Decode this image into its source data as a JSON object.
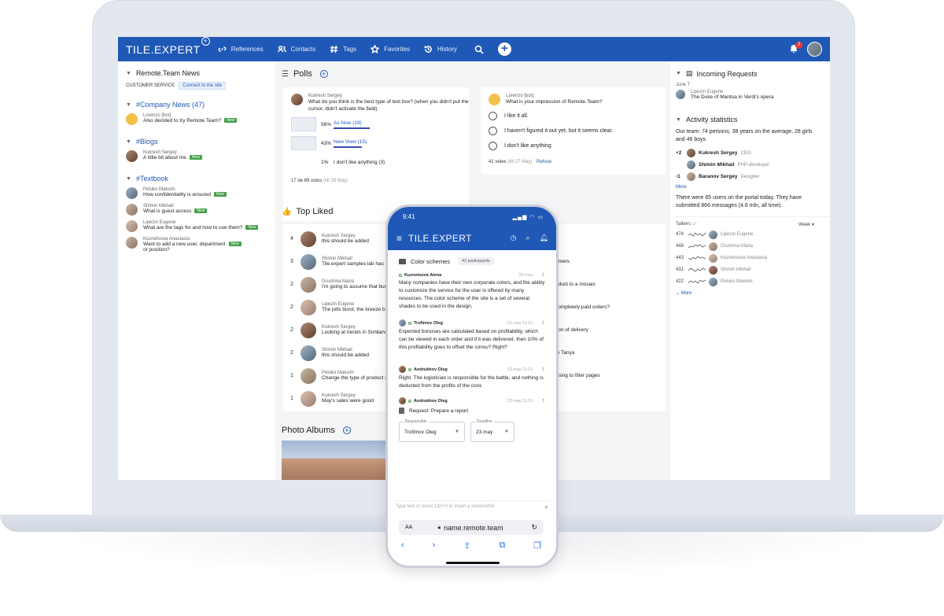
{
  "app": {
    "logo_text": "TILE.EXPERT",
    "logo_plus": "+",
    "nav": [
      {
        "label": "References"
      },
      {
        "label": "Contacts"
      },
      {
        "label": "Tags"
      },
      {
        "label": "Favorites"
      },
      {
        "label": "History"
      }
    ],
    "add_label": "+",
    "bell_count": "3",
    "accent_color": "#1f58b6"
  },
  "left": {
    "section_title": "Remote.Team News",
    "customer_service": "CUSTOMER SERVICE",
    "connect_label": "Connect to the site",
    "company_news": {
      "title": "#Company News (47)",
      "items": [
        {
          "who": "Lorenzo [bot]",
          "what": "Also decided to try Remote.Team?",
          "badge": "New"
        }
      ]
    },
    "blogs": {
      "title": "#Blogs",
      "items": [
        {
          "who": "Kukresh Sergey",
          "what": "A little bit about me",
          "badge": "New"
        }
      ]
    },
    "textbook": {
      "title": "#Textbook",
      "items": [
        {
          "who": "Pelukо Maksim",
          "what": "How confidentiality is ensured",
          "badge": "New"
        },
        {
          "who": "Shimin Mikhail",
          "what": "What is guest access",
          "badge": "New"
        },
        {
          "who": "Lipezin Eugene",
          "what": "What are the tags for and how to use them?",
          "badge": "New"
        },
        {
          "who": "Kuznetsova Anastasia",
          "what": "Want to add a new user, department",
          "what2": "or position?",
          "badge": "New"
        }
      ]
    }
  },
  "polls": {
    "title": "Polls",
    "poll1": {
      "who": "Kukresh Sergey",
      "question": "What do you think is the best type of text box? (when you didn't put the cursor, didn't activate the field)",
      "options": [
        {
          "pct": "56%",
          "label": "As Now (19)"
        },
        {
          "pct": "43%",
          "label": "New View (15)"
        },
        {
          "pct": "1%",
          "label": "I don't like anything (3)"
        }
      ],
      "votes": "17 de 89 votos",
      "till": "(till 28 May)"
    },
    "poll2": {
      "who": "Lorenzo [bot]",
      "question": "What is your impression of Remote.Team?",
      "options": [
        "I like it all.",
        "I haven't figured it out yet, but it seems clear.",
        "I don't like anything"
      ],
      "votes": "41 votes",
      "till": "(till 27 May)",
      "refuse": "Refuse"
    }
  },
  "top_liked": {
    "title": "Top Liked",
    "rows": [
      {
        "n": "4",
        "who": "Kukresh Sergey",
        "what": "this should be added"
      },
      {
        "n": "3",
        "who": "Shimin Mikhail",
        "what": "Tile.expert samples lab has an"
      },
      {
        "n": "2",
        "who": "Grushina Maria",
        "what": "I'm going to assume that burr"
      },
      {
        "n": "2",
        "who": "Lipezin Eugene",
        "what": "The jolts burst, the breeze bl"
      },
      {
        "n": "2",
        "who": "Kukresh Sergey",
        "what": "Looking at trends in Similarwe"
      },
      {
        "n": "2",
        "who": "Shimin Mikhail",
        "what": "this should be added"
      },
      {
        "n": "1",
        "who": "Pelukо Maksim",
        "what": "Change the type of product in"
      },
      {
        "n": "1",
        "who": "Kukresh Sergey",
        "what": "May's sales were good"
      }
    ],
    "right_fragments": [
      "omers",
      "oduct to a mosaic",
      "completely paid orders?",
      "tion of delivery",
      "to Tanya",
      "rtsing to filter pages"
    ]
  },
  "photo_albums": {
    "title": "Photo Albums"
  },
  "right": {
    "incoming": {
      "title": "Incoming Requests",
      "date": "June 7",
      "who": "Lipezin Eugene",
      "what": "The Duke of Mantua in Verdi's opera"
    },
    "activity": {
      "title": "Activity statistics",
      "summary": "Our team: 74 persons, 38 years on the average, 28 girls and 46 boys",
      "rows": [
        {
          "delta": "+2",
          "name": "Kukresh Sergey",
          "role": "CEO"
        },
        {
          "delta": "",
          "name": "Shimin Mikhail",
          "role": "PHP-developer"
        },
        {
          "delta": "-1",
          "name": "Baranov Sergey",
          "role": "Designer"
        }
      ],
      "more": "More",
      "today": "There were 65 users on the portal today. They have submitted 866 messages (4.6 mln, all time)."
    },
    "talkers": {
      "label": "Talkers ↓↑",
      "period": "Week",
      "rows": [
        {
          "count": "474",
          "name": "Lipezin Eugene"
        },
        {
          "count": "448",
          "name": "Grushina Maria"
        },
        {
          "count": "443",
          "name": "Kuznetsova Anastasia"
        },
        {
          "count": "431",
          "name": "Shimin Mikhail"
        },
        {
          "count": "422",
          "name": "Pelukо Maksim"
        }
      ],
      "more": "More"
    }
  },
  "phone": {
    "time": "9:41",
    "logo": "TILE.EXPERT",
    "topic": "Color schemes",
    "participants": "42 participants",
    "messages": [
      {
        "who": "Kuznetsova Alena",
        "time": "",
        "body": "Many companies have their own corporate colors, and the ability to customize the service for the user is offered by many resources. The color scheme of the site is a set of several shades to be used in the design."
      },
      {
        "who": "Trofimov Oleg",
        "time": "23 may 11:01",
        "body": "Expected bonuses are calculated based on profitability, which can be viewed in each order and if it was delivered, then 10% of this profitability goes to offset the consu? Right?"
      },
      {
        "who": "Andrukhov Oleg",
        "time": "23 may 11:01",
        "body": "Right. The logistician is responsible for the battle, and nothing is deducted from the profits of the cons"
      },
      {
        "who": "Andrukhov Oleg",
        "time": "23 may 11:01",
        "body": ""
      }
    ],
    "first_time": "23 may",
    "request": "Request: Prepare a report",
    "responsible_label": "Responsible",
    "responsible_value": "Trofimov Oleg",
    "deadline_label": "Deadline",
    "deadline_value": "23 may",
    "input_placeholder": "Type text or press Ctrl+V to insert a screenshot",
    "url": "name.remote.team",
    "aa": "AA"
  }
}
